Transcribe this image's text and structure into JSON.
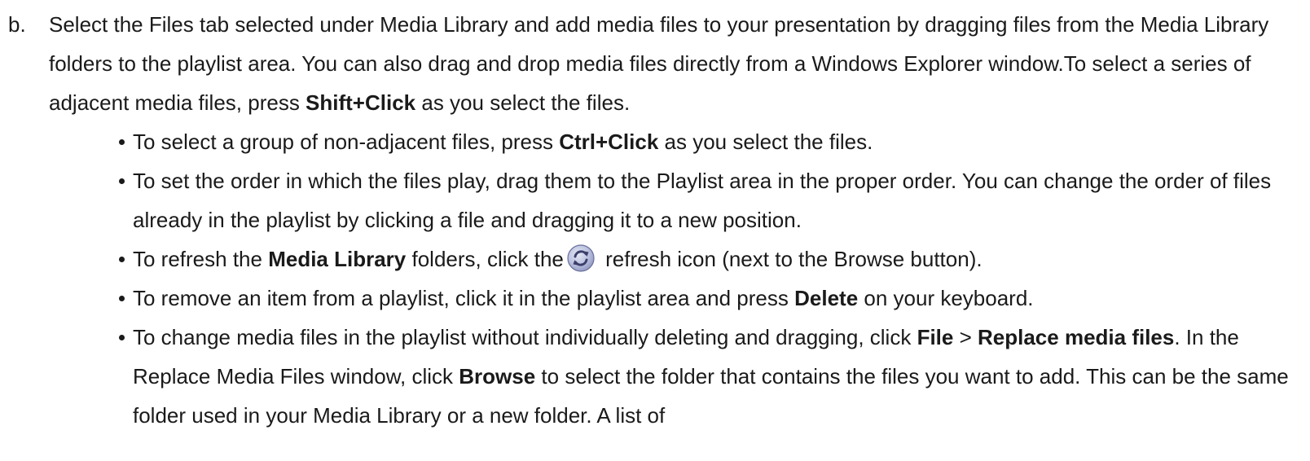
{
  "step": {
    "letter": "b.",
    "intro": {
      "p1": "Select the Files tab selected under Media Library and add media files to your presentation by dragging files from the Media Library folders to the playlist area. You can also drag and drop media files directly from a Windows Explorer window.To select a series of adjacent media files, press ",
      "b1": "Shift+Click",
      "p2": " as you select the files."
    }
  },
  "bullets": {
    "b0": {
      "p1": "To select a group of non-adjacent files, press ",
      "b1": "Ctrl+Click",
      "p2": " as you select the files."
    },
    "b1": {
      "p1": "To set the order in which the files play, drag them to the Playlist area in the proper order. You can change the order of files already in the playlist by clicking a file and dragging it to a new position."
    },
    "b2": {
      "p1": "To refresh the ",
      "b1": "Media Library",
      "p2": " folders, click the",
      "p3": " refresh icon (next to the Browse button)."
    },
    "b3": {
      "p1": "To remove an item from a playlist, click it in the playlist area and press ",
      "b1": "Delete",
      "p2": " on your keyboard."
    },
    "b4": {
      "p1": "To change media files in the playlist without individually deleting and dragging, click ",
      "b1": "File",
      "p2": " > ",
      "b2": "Replace media files",
      "p3": ". In the Replace Media Files window, click ",
      "b3": "Browse",
      "p4": " to select the folder that contains the files you want to add. This can be the same folder used in your Media Library or a new folder. A list of"
    }
  },
  "icons": {
    "refresh": "refresh-icon"
  },
  "colors": {
    "text": "#1a1a1a",
    "icon_ring": "#6a6f9a",
    "icon_fill": "#b9c0de"
  }
}
